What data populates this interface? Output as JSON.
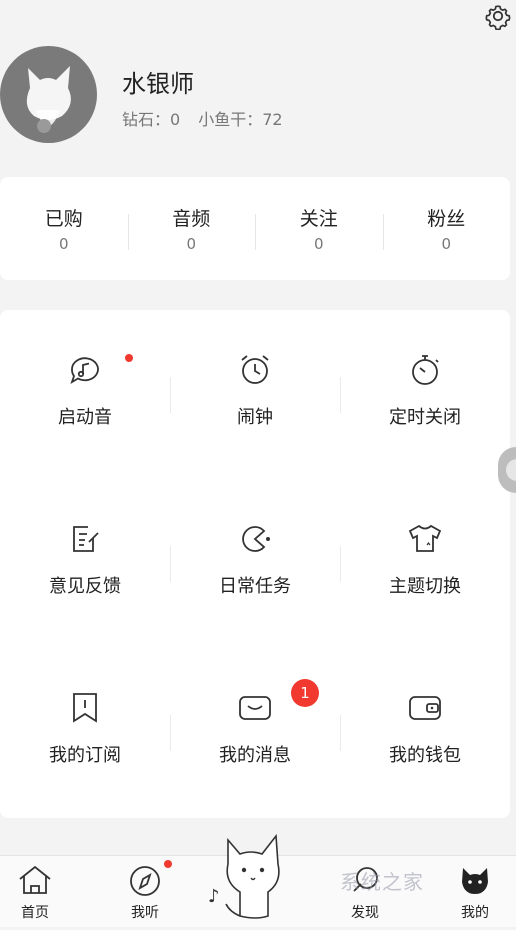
{
  "profile": {
    "name": "水银师",
    "diamonds": "钻石：0",
    "fish": "小鱼干：72"
  },
  "stats": [
    {
      "label": "已购",
      "value": "0"
    },
    {
      "label": "音频",
      "value": "0"
    },
    {
      "label": "关注",
      "value": "0"
    },
    {
      "label": "粉丝",
      "value": "0"
    }
  ],
  "tools": [
    {
      "label": "启动音",
      "icon": "chat-music-icon"
    },
    {
      "label": "闹钟",
      "icon": "alarm-clock-icon"
    },
    {
      "label": "定时关闭",
      "icon": "stopwatch-icon"
    },
    {
      "label": "意见反馈",
      "icon": "feedback-edit-icon"
    },
    {
      "label": "日常任务",
      "icon": "pacman-icon"
    },
    {
      "label": "主题切换",
      "icon": "tshirt-icon"
    },
    {
      "label": "我的订阅",
      "icon": "bookmark-icon"
    },
    {
      "label": "我的消息",
      "icon": "message-icon"
    },
    {
      "label": "我的钱包",
      "icon": "wallet-icon"
    }
  ],
  "message_badge": "1",
  "tabs": [
    {
      "label": "首页",
      "icon": "home-icon"
    },
    {
      "label": "我听",
      "icon": "compass-icon"
    },
    {
      "label": "发现",
      "icon": "discover-icon"
    },
    {
      "label": "我的",
      "icon": "cat-head-icon"
    }
  ],
  "watermark": "系统之家",
  "colors": {
    "accent_red": "#f2392f",
    "background": "#f3f3f3"
  }
}
